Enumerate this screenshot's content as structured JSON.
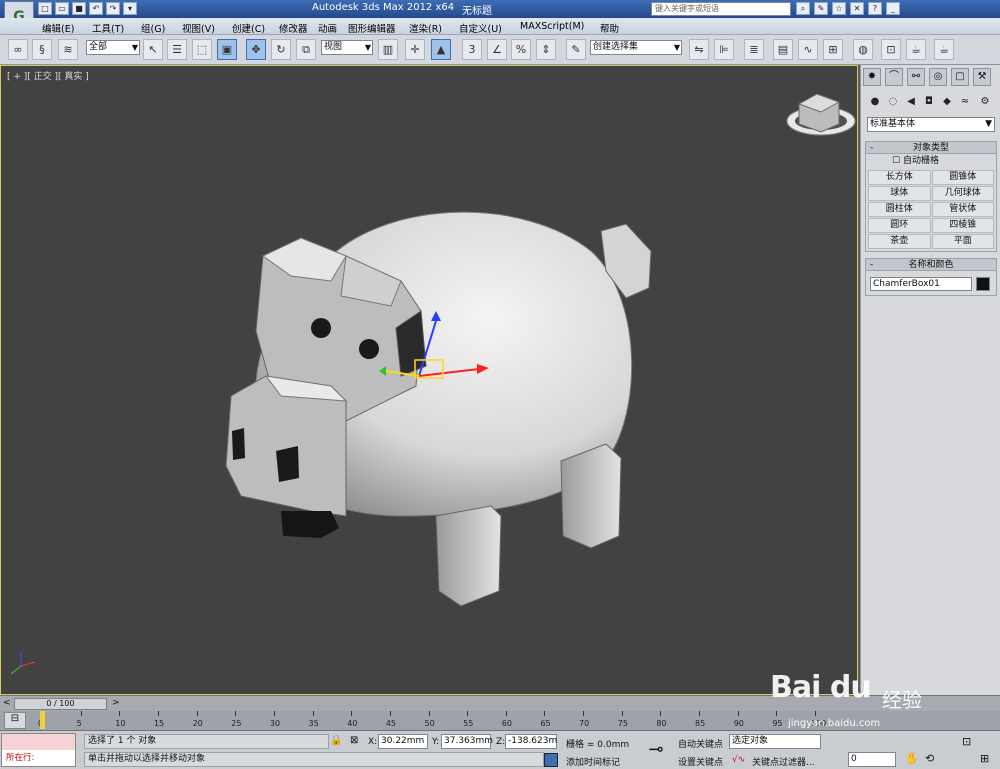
{
  "titlebar": {
    "app_title": "Autodesk 3ds Max  2012 x64",
    "document": "无标题",
    "search_placeholder": "键入关键字或短语"
  },
  "menu": [
    "编辑(E)",
    "工具(T)",
    "组(G)",
    "视图(V)",
    "创建(C)",
    "修改器",
    "动画",
    "图形编辑器",
    "渲染(R)",
    "自定义(U)",
    "MAXScript(M)",
    "帮助"
  ],
  "toolbar": {
    "selection_filter": "全部",
    "ref_coord": "视图",
    "named_selection": "创建选择集"
  },
  "viewport": {
    "label": "[ + ][ 正交 ][ 真实 ]"
  },
  "command_panel": {
    "category": "标准基本体",
    "object_type_title": "对象类型",
    "autogrid_label": "自动栅格",
    "primitives": [
      "长方体",
      "圆锥体",
      "球体",
      "几何球体",
      "圆柱体",
      "管状体",
      "圆环",
      "四棱锥",
      "茶壶",
      "平面"
    ],
    "name_color_title": "名称和颜色",
    "object_name": "ChamferBox01",
    "object_color": "#111111"
  },
  "timeline": {
    "slider_text": "0 / 100",
    "ticks": [
      "0",
      "5",
      "10",
      "15",
      "20",
      "25",
      "30",
      "35",
      "40",
      "45",
      "50",
      "55",
      "60",
      "65",
      "70",
      "75",
      "80",
      "85",
      "90",
      "95",
      "100"
    ]
  },
  "status": {
    "maxscript_text": "所在行:",
    "selection_info": "选择了 1 个 对象",
    "prompt": "单击并拖动以选择并移动对象",
    "x_label": "X:",
    "x_value": "30.22mm",
    "y_label": "Y:",
    "y_value": "37.363mm",
    "z_label": "Z:",
    "z_value": "-138.623m",
    "grid": "栅格 = 0.0mm",
    "add_time_tag": "添加时间标记",
    "auto_key": "自动关键点",
    "set_key": "设置关键点",
    "key_target": "选定对象",
    "key_filters": "关键点过滤器...",
    "frame": "0"
  },
  "watermark": {
    "logo": "Bai du",
    "cn": "经验",
    "url": "jingyan.baidu.com"
  }
}
